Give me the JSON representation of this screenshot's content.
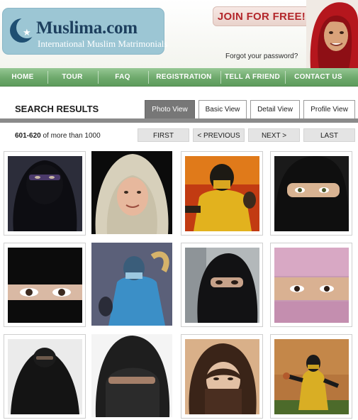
{
  "header": {
    "logo_title": "Muslima.com",
    "logo_subtitle": "International Muslim Matrimonials",
    "join_label": "JOIN FOR FREE!",
    "forgot_password": "Forgot your password?",
    "icons": [
      "crescent-moon-icon",
      "star-icon"
    ],
    "colors": {
      "logo_bg": "#9cc6d4",
      "logo_text": "#1d3f5e",
      "join_text": "#b3262b",
      "nav_green": "#6ea96c"
    }
  },
  "nav": {
    "items": [
      "HOME",
      "TOUR",
      "FAQ",
      "REGISTRATION",
      "TELL A FRIEND",
      "CONTACT US"
    ]
  },
  "results": {
    "title": "SEARCH RESULTS",
    "tabs": [
      "Photo View",
      "Basic View",
      "Detail View",
      "Profile View"
    ],
    "active_tab": "Photo View",
    "range_bold": "601-620",
    "range_rest": "of more than 1000",
    "pagination": [
      "FIRST",
      "< PREVIOUS",
      "NEXT >",
      "LAST"
    ]
  },
  "gallery": {
    "photos": [
      "veiled-woman-black-niqab-photo",
      "woman-cream-headscarf-photo",
      "yellow-ninja-fighter-photo",
      "woman-black-niqab-eyes-photo",
      "black-niqab-eyes-closeup-photo",
      "blue-ninja-fighter-photo",
      "woman-niqab-in-car-photo",
      "pink-hijab-eyes-photo",
      "black-burqa-woman-photo",
      "woman-niqab-white-background-photo",
      "woman-brown-hijab-photo",
      "yellow-ninja-fighting-stance-photo"
    ]
  }
}
